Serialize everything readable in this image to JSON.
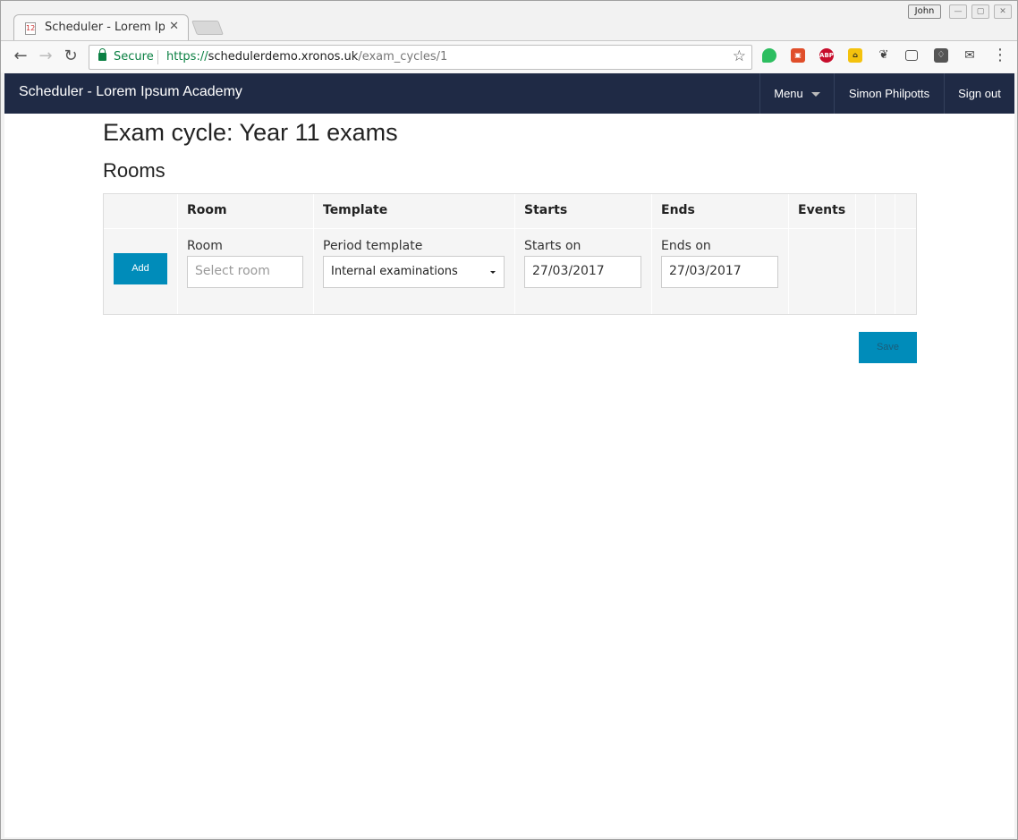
{
  "browser": {
    "tab_title": "Scheduler - Lorem Ipsum Academy",
    "profile_name": "John",
    "security_label": "Secure",
    "url_scheme": "https://",
    "url_host": "schedulerdemo.xronos.uk",
    "url_path": "/exam_cycles/1",
    "extension_icons": [
      "evernote-icon",
      "office-icon",
      "adblock-plus-icon",
      "extension-house-icon",
      "extension-bird-icon",
      "cast-icon",
      "keep-icon",
      "mail-icon"
    ]
  },
  "app": {
    "brand": "Scheduler - Lorem Ipsum Academy",
    "nav": {
      "menu_label": "Menu",
      "user_name": "Simon Philpotts",
      "signout_label": "Sign out"
    },
    "colors": {
      "navbar": "#1f2a45",
      "primary_button": "#008cba"
    }
  },
  "page": {
    "title": "Exam cycle: Year 11 exams",
    "section_title": "Rooms",
    "table": {
      "headers": [
        "",
        "Room",
        "Template",
        "Starts",
        "Ends",
        "Events",
        "",
        "",
        ""
      ],
      "new_row": {
        "add_label": "Add",
        "room_label": "Room",
        "room_placeholder": "Select room",
        "template_label": "Period template",
        "template_value": "Internal examinations",
        "starts_label": "Starts on",
        "starts_value": "27/03/2017",
        "ends_label": "Ends on",
        "ends_value": "27/03/2017"
      }
    },
    "save_label": "Save"
  }
}
